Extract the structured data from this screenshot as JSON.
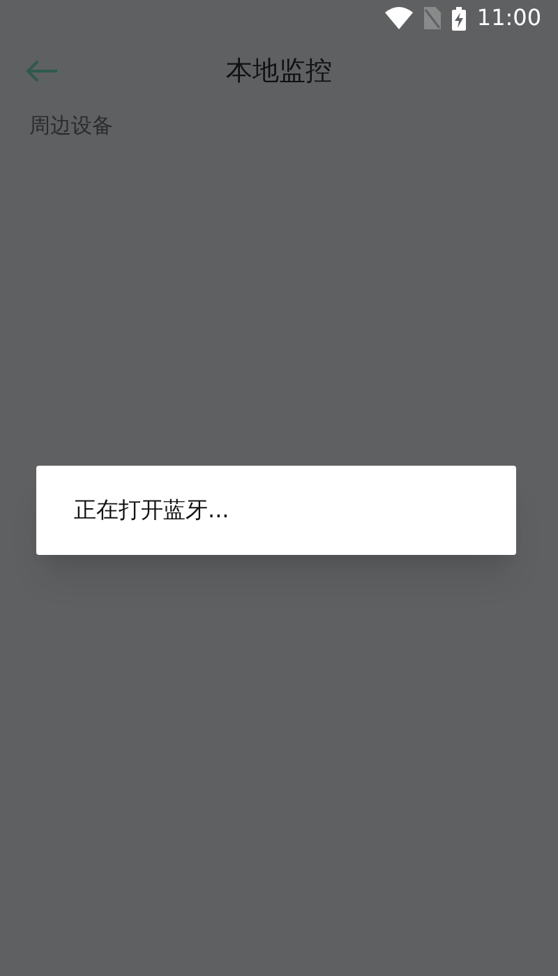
{
  "status_bar": {
    "time": "11:00"
  },
  "toolbar": {
    "title": "本地监控"
  },
  "section": {
    "label": "周边设备"
  },
  "dialog": {
    "message": "正在打开蓝牙..."
  }
}
